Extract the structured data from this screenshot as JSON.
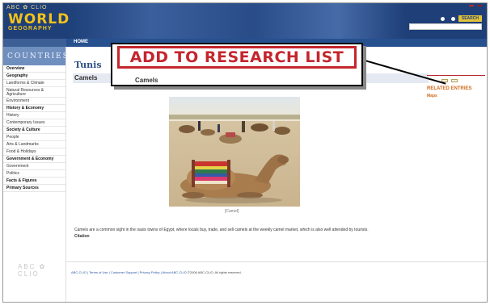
{
  "header": {
    "abc_clio": "ABC ✿ CLIO",
    "logo_world": "WORLD",
    "logo_geography": "GEOGRAPHY",
    "countries_tab": "",
    "top_links": [
      "",
      ""
    ],
    "tools": [
      ""
    ],
    "search_button": "SEARCH"
  },
  "nav": {
    "home": "HOME",
    "right_links": [
      "",
      "",
      ""
    ]
  },
  "sidebar": {
    "heading": "COUNTRIES",
    "items": [
      {
        "label": "Overview",
        "type": "section"
      },
      {
        "label": "Geography",
        "type": "section"
      },
      {
        "label": "Landforms & Climate",
        "type": "item"
      },
      {
        "label": "Natural Resources & Agriculture",
        "type": "item2"
      },
      {
        "label": "Environment",
        "type": "item"
      },
      {
        "label": "History & Economy",
        "type": "section"
      },
      {
        "label": "History",
        "type": "item"
      },
      {
        "label": "Contemporary Issues",
        "type": "item"
      },
      {
        "label": "Society & Culture",
        "type": "section"
      },
      {
        "label": "People",
        "type": "item"
      },
      {
        "label": "Arts & Landmarks",
        "type": "item"
      },
      {
        "label": "Food & Holidays",
        "type": "item"
      },
      {
        "label": "Government & Economy",
        "type": "section"
      },
      {
        "label": "Government",
        "type": "item"
      },
      {
        "label": "Politics",
        "type": "item"
      },
      {
        "label": "Facts & Figures",
        "type": "section"
      },
      {
        "label": "Primary Sources",
        "type": "section"
      }
    ],
    "abc_clio": "ABC ✿ CLIO"
  },
  "main": {
    "page_title": "Tunis",
    "section_title": "Camels",
    "section_sub": "",
    "caption": "[Camel]",
    "body_text": "Camels are a common sight in the oasis towns of Egypt, where locals buy, trade, and sell camels at the weekly camel market, which is also well attended by tourists.",
    "body_link": "Citation"
  },
  "right_col": {
    "add_to_research": "",
    "buttons": [
      "",
      ""
    ],
    "related": "RELATED ENTRIES",
    "maps_heading": "Maps",
    "map_link": ""
  },
  "footer": {
    "links": "ABC-CLIO | Terms of Use | Customer Support | Privacy Policy | About ABC-CLIO",
    "copyright": "©2006 ABC-CLIO. All rights reserved."
  },
  "callout": {
    "label": "ADD TO RESEARCH LIST",
    "page_title": "Camels"
  },
  "colors": {
    "header_blue": "#1e3f78",
    "logo_gold": "#f2c21b",
    "callout_red": "#c4262e",
    "sidebar_heading": "#6f8fbf"
  }
}
